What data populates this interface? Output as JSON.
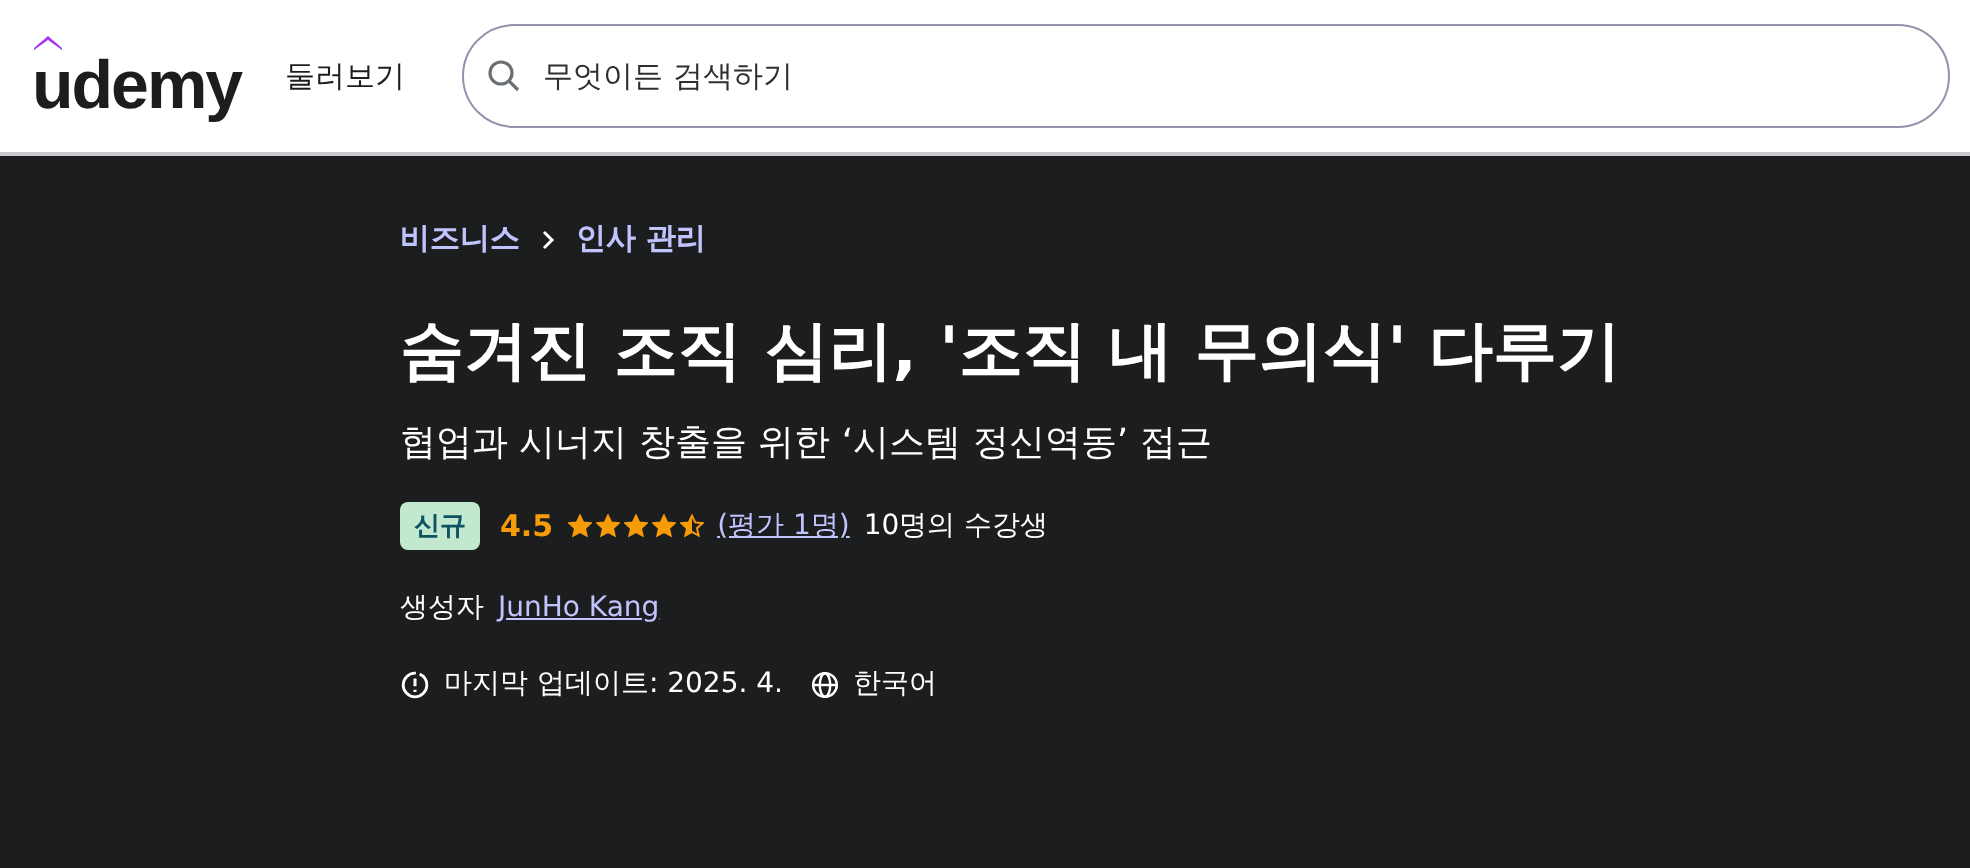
{
  "header": {
    "logo": "udemy",
    "explore": "둘러보기",
    "search": {
      "placeholder": "무엇이든 검색하기"
    }
  },
  "breadcrumb": [
    "비즈니스",
    "인사 관리"
  ],
  "course": {
    "title": "숨겨진 조직 심리, '조직 내 무의식' 다루기",
    "subtitle": "협업과 시너지 창출을 위한 ‘시스템 정신역동’ 접근",
    "badge": "신규",
    "rating": "4.5",
    "stars": 4.5,
    "reviews": "(평가 1명)",
    "students": "10명의 수강생",
    "creator_label": "생성자",
    "creator": "JunHo Kang",
    "updated": "마지막 업데이트: 2025. 4.",
    "language": "한국어"
  }
}
